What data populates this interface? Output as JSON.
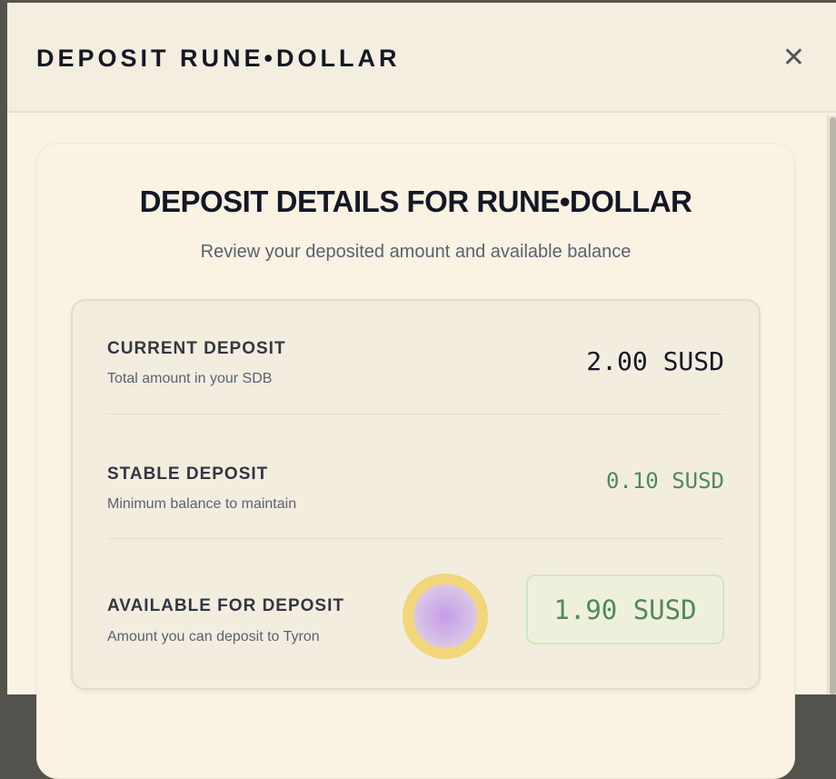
{
  "header": {
    "title": "DEPOSIT RUNE•DOLLAR",
    "close_icon": "close-icon"
  },
  "card": {
    "title": "DEPOSIT DETAILS FOR RUNE•DOLLAR",
    "subtitle": "Review your deposited amount and available balance"
  },
  "rows": [
    {
      "label": "CURRENT DEPOSIT",
      "desc": "Total amount in your SDB",
      "value": "2.00 SUSD"
    },
    {
      "label": "STABLE DEPOSIT",
      "desc": "Minimum balance to maintain",
      "value": "0.10 SUSD"
    },
    {
      "label": "AVAILABLE FOR DEPOSIT",
      "desc": "Amount you can deposit to Tyron",
      "value": "1.90 SUSD"
    }
  ],
  "colors": {
    "accent_green": "#4f8a5c",
    "text": "#141824"
  }
}
